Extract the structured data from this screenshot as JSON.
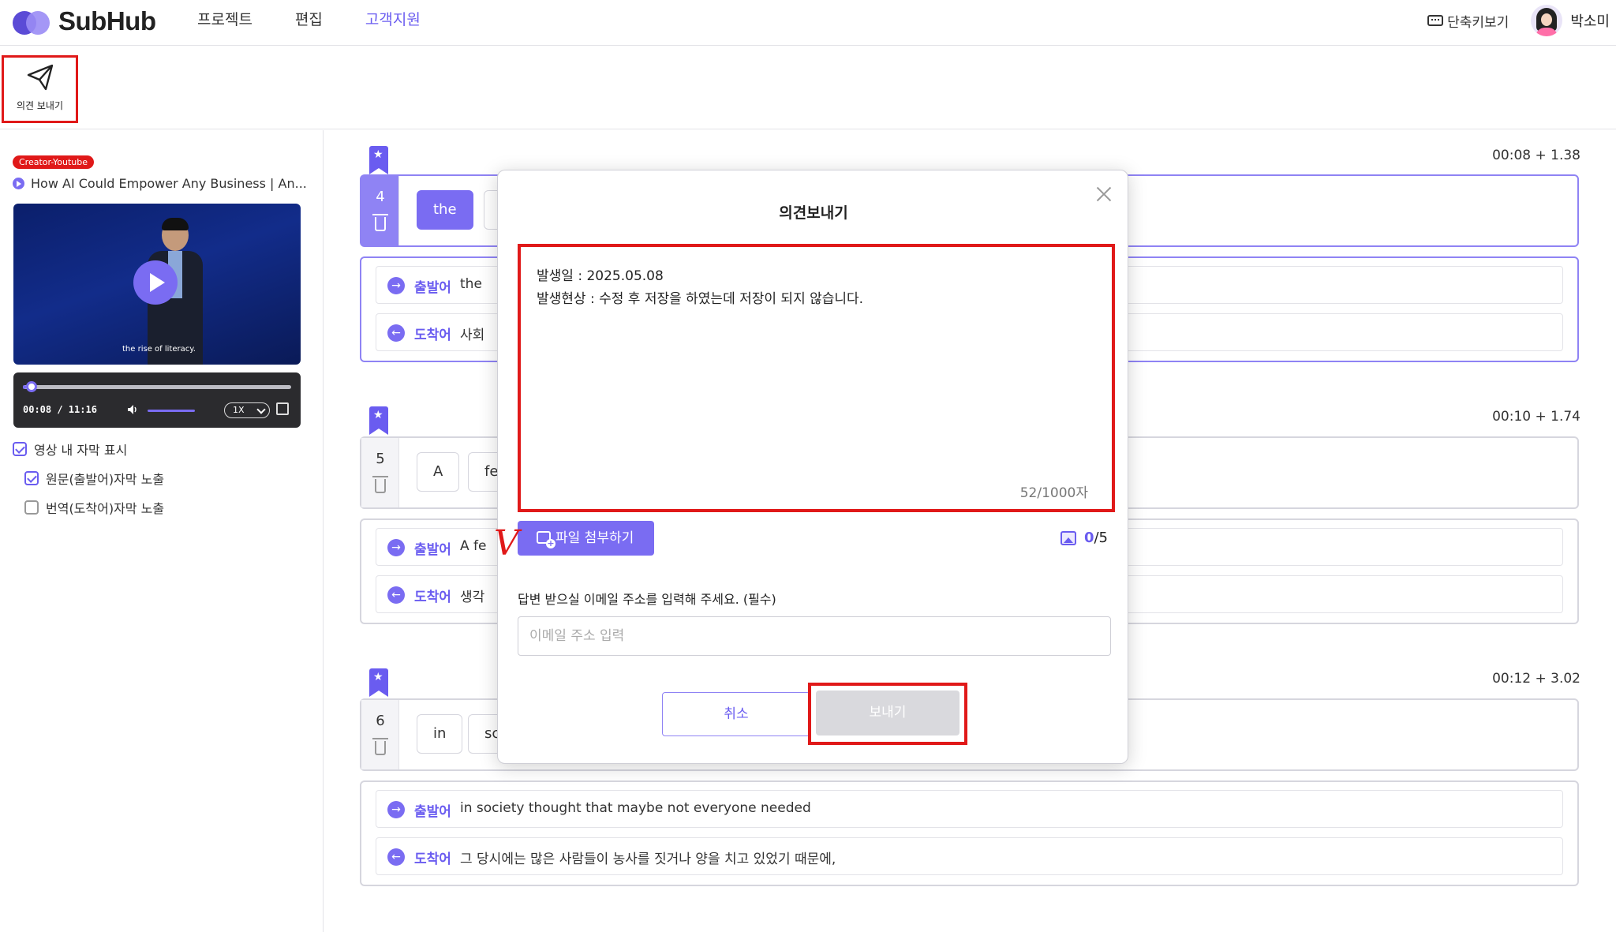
{
  "header": {
    "logo_text": "SubHub",
    "nav": [
      "프로젝트",
      "편집",
      "고객지원"
    ],
    "active_nav_index": 2,
    "shortcut_label": "단축키보기",
    "username": "박소미"
  },
  "toolbar": {
    "feedback_label": "의견 보내기"
  },
  "sidebar": {
    "badge": "Creator-Youtube",
    "video_title": "How AI Could Empower Any Business | An...",
    "thumb_caption": "the rise of literacy.",
    "player": {
      "time": "00:08 / 11:16",
      "speed": "1X",
      "progress": 0.012,
      "volume": 1.0
    },
    "options": [
      {
        "label": "영상 내 자막 표시",
        "checked": true
      },
      {
        "label": "원문(출발어)자막 노출",
        "checked": true
      },
      {
        "label": "번역(도착어)자막 노출",
        "checked": false
      }
    ]
  },
  "segments": [
    {
      "timestamp": "00:08 + 1.38",
      "number": "4",
      "words": [
        "the"
      ],
      "source_label": "출발어",
      "source_text": "the",
      "target_label": "도착어",
      "target_text": "사회"
    },
    {
      "timestamp": "00:10 + 1.74",
      "number": "5",
      "words": [
        "A",
        "fe"
      ],
      "source_label": "출발어",
      "source_text": "A fe",
      "target_label": "도착어",
      "target_text": "생각"
    },
    {
      "timestamp": "00:12 + 3.02",
      "number": "6",
      "words": [
        "in",
        "sc"
      ],
      "source_label": "출발어",
      "source_text": "in society thought that maybe not everyone needed",
      "target_label": "도착어",
      "target_text": "그 당시에는 많은 사람들이 농사를 짓거나 양을 치고 있었기 때문에,"
    }
  ],
  "modal": {
    "title": "의견보내기",
    "lines": [
      "발생일 : 2025.05.08",
      "발생현상 : 수정 후 저장을 하였는데 저장이 되지 않습니다."
    ],
    "char_count": "52/1000자",
    "attach_label": "파일 첨부하기",
    "annotation_mark": "V",
    "image_count_current": "0",
    "image_count_max": "/5",
    "email_label": "답변 받으실 이메일 주소를 입력해 주세요. (필수)",
    "email_placeholder": "이메일 주소 입력",
    "cancel_label": "취소",
    "send_label": "보내기"
  },
  "colors": {
    "accent": "#6a5cf0",
    "highlight": "#e01919",
    "disabled": "#d9d9dd"
  }
}
